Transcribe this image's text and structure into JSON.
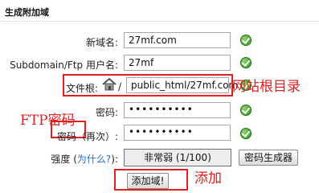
{
  "title": "生成附加域",
  "form": {
    "new_domain_label": "新域名:",
    "new_domain_value": "27mf.com",
    "ftp_user_label": "Subdomain/Ftp 用户名:",
    "ftp_user_value": "27mf",
    "docroot_label": "文件根:",
    "docroot_prefix": "/",
    "docroot_value": "public_html/27mf.com",
    "password_label": "密码:",
    "password_value": "••••••••••",
    "password_again_label": "密码（再次）:",
    "password_again_value": "••••••••••",
    "strength_label_prefix": "强度 (",
    "strength_help_link": "为什么?",
    "strength_label_suffix": "):",
    "strength_value": "非常弱 (1/100)",
    "generator_button": "密码生成器",
    "submit_button": "添加域!"
  },
  "annotations": {
    "docroot_note": "网站根目录",
    "ftp_password_note": "FTP密码",
    "add_note": "添加"
  },
  "colors": {
    "annotation_red": "#e02020",
    "check_green": "#2b8a1d",
    "link_blue": "#2a6ec8"
  }
}
